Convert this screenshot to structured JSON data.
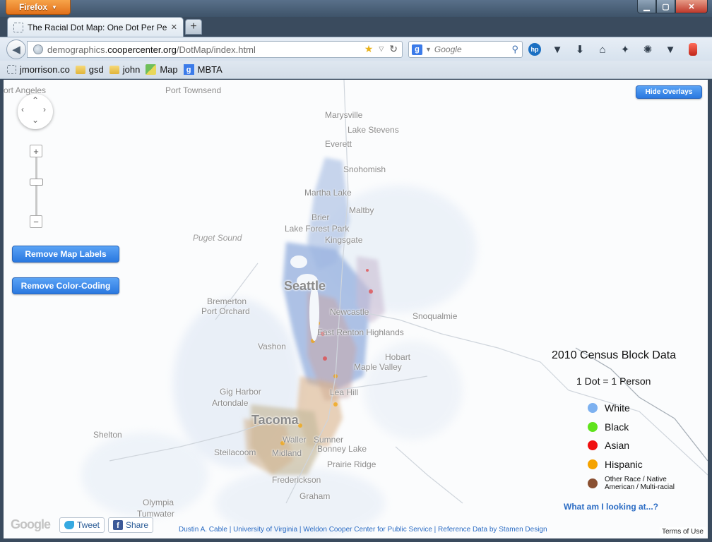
{
  "browser": {
    "app_button": "Firefox",
    "tab_title": "The Racial Dot Map: One Dot Per Person...",
    "url_prefix": "demographics.",
    "url_domain": "coopercenter.org",
    "url_path": "/DotMap/index.html",
    "search_placeholder": "Google",
    "bookmarks": [
      {
        "label": "jmorrison.co",
        "icon": "dashed-page-icon"
      },
      {
        "label": "gsd",
        "icon": "folder-icon"
      },
      {
        "label": "john",
        "icon": "folder-icon"
      },
      {
        "label": "Map",
        "icon": "maps-icon"
      },
      {
        "label": "MBTA",
        "icon": "google-icon"
      }
    ]
  },
  "map": {
    "hide_overlays": "Hide Overlays",
    "remove_labels": "Remove Map Labels",
    "remove_color": "Remove Color-Coding",
    "places": [
      {
        "id": "port-angeles",
        "label": "ort Angeles"
      },
      {
        "id": "port-townsend",
        "label": "Port Townsend"
      },
      {
        "id": "marysville",
        "label": "Marysville"
      },
      {
        "id": "lake-stevens",
        "label": "Lake Stevens"
      },
      {
        "id": "everett",
        "label": "Everett"
      },
      {
        "id": "snohomish",
        "label": "Snohomish"
      },
      {
        "id": "martha-lake",
        "label": "Martha Lake"
      },
      {
        "id": "maltby",
        "label": "Maltby"
      },
      {
        "id": "brier",
        "label": "Brier"
      },
      {
        "id": "lake-forest-park",
        "label": "Lake Forest Park"
      },
      {
        "id": "kingsgate",
        "label": "Kingsgate"
      },
      {
        "id": "puget-sound",
        "label": "Puget Sound"
      },
      {
        "id": "seattle",
        "label": "Seattle"
      },
      {
        "id": "bremerton",
        "label": "Bremerton"
      },
      {
        "id": "port-orchard",
        "label": "Port Orchard"
      },
      {
        "id": "newcastle",
        "label": "Newcastle"
      },
      {
        "id": "snoqualmie",
        "label": "Snoqualmie"
      },
      {
        "id": "east-renton-highlands",
        "label": "East Renton Highlands"
      },
      {
        "id": "vashon",
        "label": "Vashon"
      },
      {
        "id": "hobart",
        "label": "Hobart"
      },
      {
        "id": "maple-valley",
        "label": "Maple Valley"
      },
      {
        "id": "gig-harbor",
        "label": "Gig Harbor"
      },
      {
        "id": "artondale",
        "label": "Artondale"
      },
      {
        "id": "lea-hill",
        "label": "Lea Hill"
      },
      {
        "id": "tacoma",
        "label": "Tacoma"
      },
      {
        "id": "shelton",
        "label": "Shelton"
      },
      {
        "id": "waller",
        "label": "Waller"
      },
      {
        "id": "sumner",
        "label": "Sumner"
      },
      {
        "id": "steilacoom",
        "label": "Steilacoom"
      },
      {
        "id": "midland",
        "label": "Midland"
      },
      {
        "id": "bonney-lake",
        "label": "Bonney Lake"
      },
      {
        "id": "prairie-ridge",
        "label": "Prairie Ridge"
      },
      {
        "id": "frederickson",
        "label": "Frederickson"
      },
      {
        "id": "graham",
        "label": "Graham"
      },
      {
        "id": "olympia",
        "label": "Olympia"
      },
      {
        "id": "tumwater",
        "label": "Tumwater"
      }
    ]
  },
  "legend": {
    "title": "2010 Census Block Data",
    "subtitle": "1 Dot = 1 Person",
    "items": [
      {
        "label": "White",
        "color": "#7db1f0"
      },
      {
        "label": "Black",
        "color": "#5fe31c"
      },
      {
        "label": "Asian",
        "color": "#f01010"
      },
      {
        "label": "Hispanic",
        "color": "#f5a300"
      },
      {
        "label": "Other Race / Native\nAmerican / Multi-racial",
        "color": "#8a5032"
      }
    ],
    "link": "What am I looking at...?"
  },
  "footer": {
    "google": "Google",
    "tweet": "Tweet",
    "share": "Share",
    "credits": "Dustin A. Cable | University of Virginia | Weldon Cooper Center for Public Service | Reference Data by Stamen Design",
    "terms": "Terms of Use"
  }
}
